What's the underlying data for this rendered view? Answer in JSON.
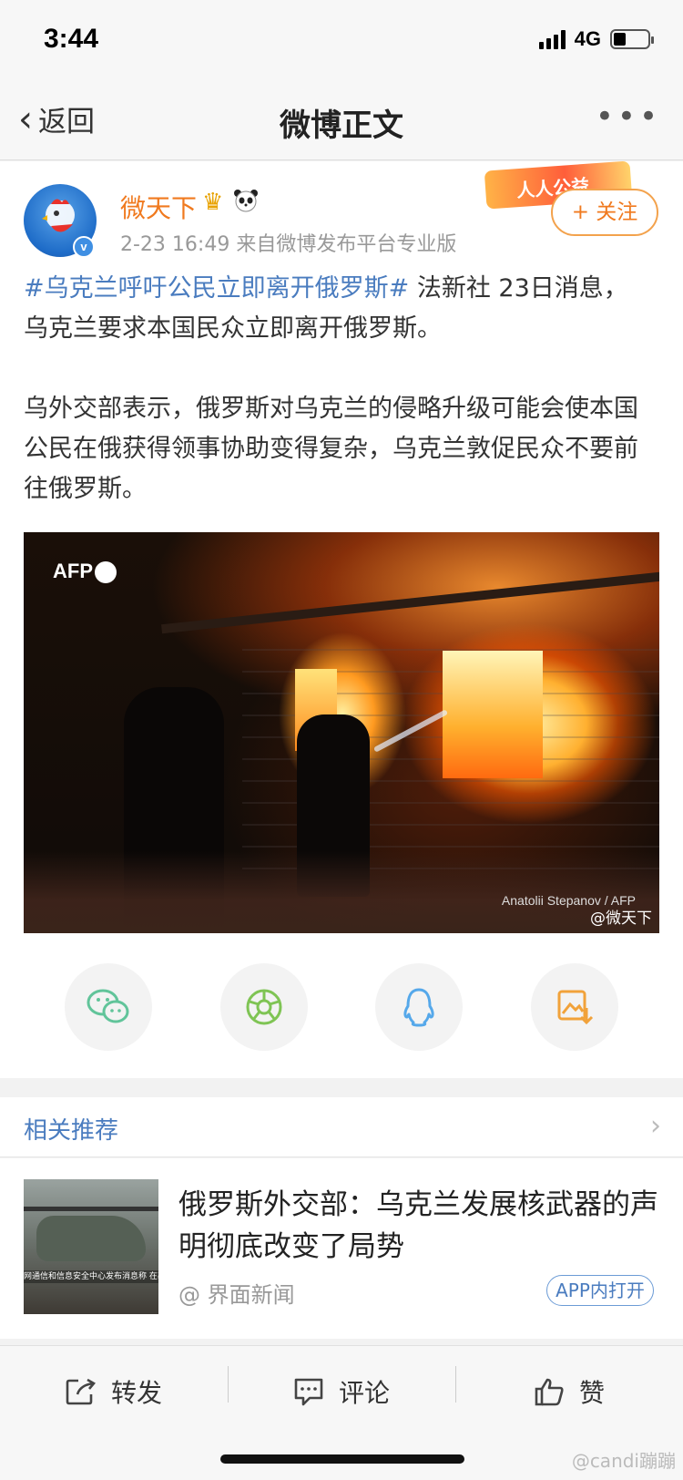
{
  "status_bar": {
    "time": "3:44",
    "network": "4G",
    "battery_level": 0.35
  },
  "nav": {
    "back_label": "返回",
    "title": "微博正文",
    "more": "•••"
  },
  "post": {
    "user_name": "微天下",
    "meta": "2-23 16:49   来自微博发布平台专业版",
    "banner_text": "人人公益",
    "follow_label": "+ 关注",
    "verified_badge": "v",
    "hashtag": "#乌克兰呼吁公民立即离开俄罗斯#",
    "lead": " 法新社 23日消息，乌克兰要求本国民众立即离开俄罗斯。",
    "paragraph_2": "乌外交部表示，俄罗斯对乌克兰的侵略升级可能会使本国公民在俄获得领事协助变得复杂，乌克兰敦促民众不要前往俄罗斯。",
    "photo": {
      "agency_logo": "AFP",
      "credit": "Anatolii Stepanov / AFP",
      "watermark": "@微天下"
    }
  },
  "share": [
    {
      "name": "wechat",
      "icon": "wechat-icon",
      "color": "#61c49a"
    },
    {
      "name": "moments",
      "icon": "moments-icon",
      "color": "#7fc454"
    },
    {
      "name": "qq",
      "icon": "qq-icon",
      "color": "#55a8ea"
    },
    {
      "name": "save-image",
      "icon": "save-image-icon",
      "color": "#f1a23a"
    }
  ],
  "related": {
    "header": "相关推荐",
    "item": {
      "title": "俄罗斯外交部：乌克兰发展核武器的声明彻底改变了局势",
      "source": "@ 界面新闻",
      "open_app": "APP内打开",
      "thumb_caption": "网通信和信息安全中心发布消息称 在基辅州上空击落一架俄罗斯卡"
    }
  },
  "actions": [
    {
      "label": "转发",
      "icon": "repost-icon"
    },
    {
      "label": "评论",
      "icon": "comment-icon"
    },
    {
      "label": "赞",
      "icon": "like-icon"
    }
  ],
  "corner_watermark": "@candi蹦蹦",
  "colors": {
    "accent_orange": "#f07a1f",
    "link_blue": "#4a7cbf",
    "page_bg": "#f2f2f2"
  }
}
